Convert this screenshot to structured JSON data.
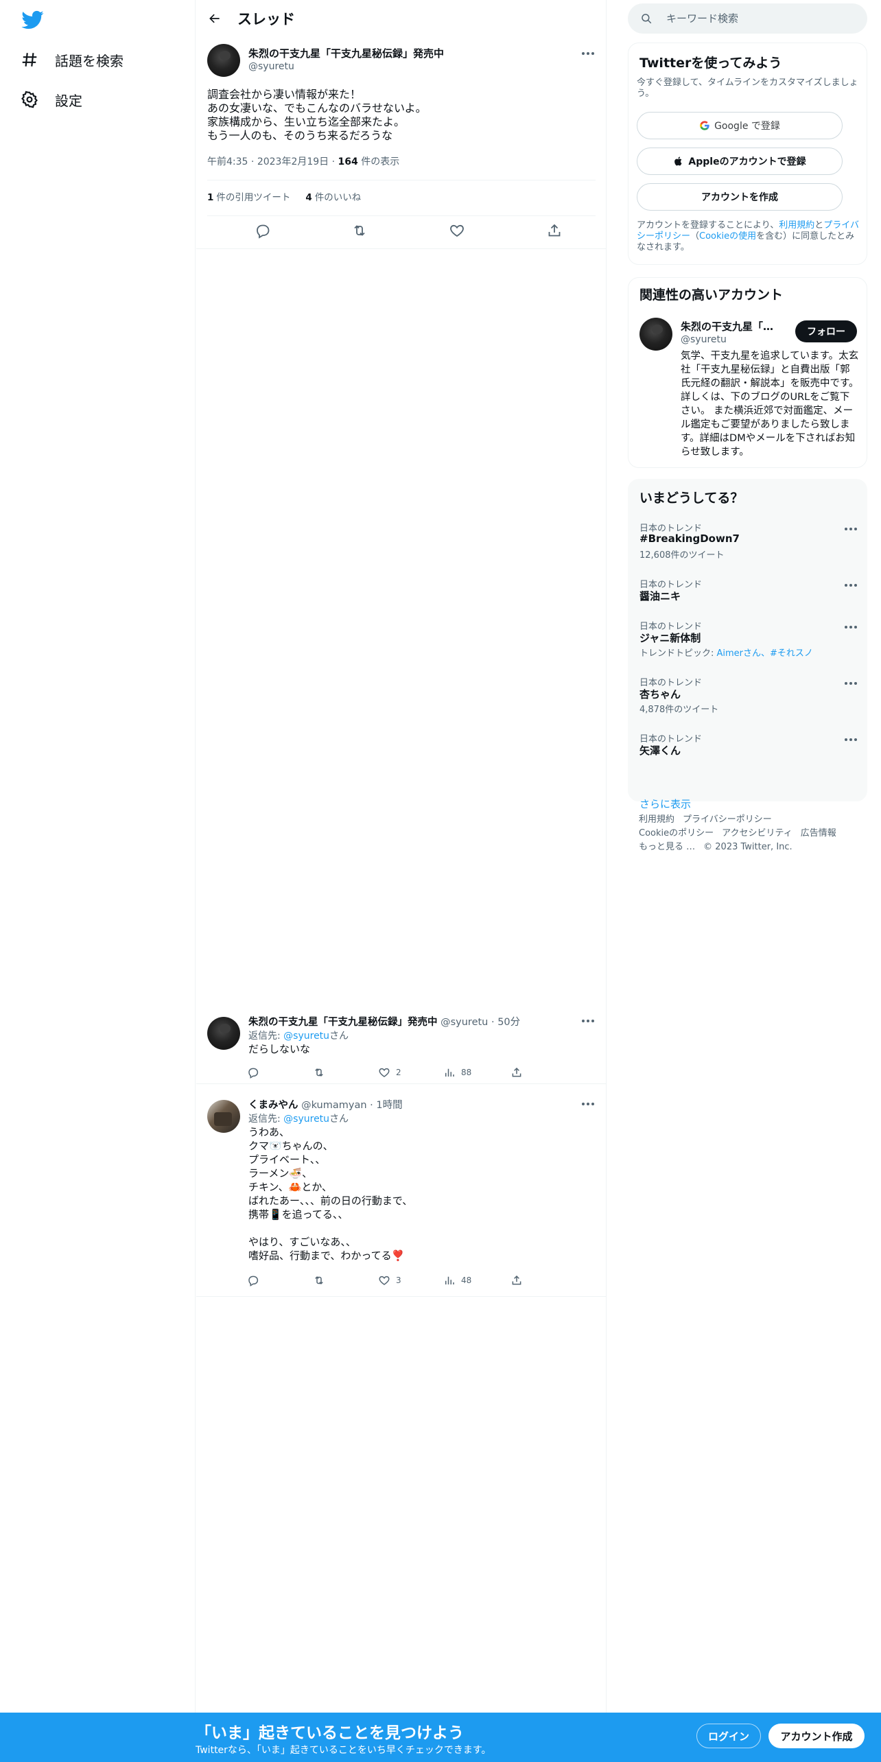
{
  "nav": {
    "items": [
      {
        "label": "話題を検索",
        "icon": "hashtag-icon"
      },
      {
        "label": "設定",
        "icon": "gear-icon"
      }
    ]
  },
  "header": {
    "title": "スレッド"
  },
  "main_tweet": {
    "author_name": "朱烈の干支九星「干支九星秘伝録」発売中",
    "author_handle": "@syuretu",
    "text_lines": [
      "調査会社から凄い情報が来た！",
      "あの女凄いな、でもこんなのバラせないよ。",
      "家族構成から、生い立ち迄全部来たよ。",
      "もう一人のも、そのうち来るだろうな"
    ],
    "time": "午前4:35",
    "date": "2023年2月19日",
    "views_count": "164",
    "views_label": "件の表示",
    "quote_count": "1",
    "quote_label": "件の引用ツイート",
    "like_count": "4",
    "like_label": "件のいいね"
  },
  "replies": [
    {
      "author_name": "朱烈の干支九星「干支九星秘伝録」発売中",
      "author_handle": "@syuretu",
      "time": "· 50分",
      "reply_to_prefix": "返信先: ",
      "reply_to_handle": "@syuretu",
      "reply_to_suffix": "さん",
      "text_lines": [
        "だらしないな"
      ],
      "likes": "2",
      "views": "88"
    },
    {
      "author_name": "くまみやん",
      "author_handle": "@kumamyan",
      "time": "· 1時間",
      "reply_to_prefix": "返信先: ",
      "reply_to_handle": "@syuretu",
      "reply_to_suffix": "さん",
      "text_lines": [
        "うわあ、",
        "クマ🐻‍❄️ちゃんの、",
        "プライベート、、",
        "ラーメン🍜、",
        "チキン、🦀とか、",
        "ばれたあー、、、前の日の行動まで、",
        "携帯📱を追ってる、、",
        "",
        "やはり、すごいなあ、、",
        "嗜好品、行動まで、わかってる❣️"
      ],
      "likes": "3",
      "views": "48"
    }
  ],
  "search": {
    "placeholder": "キーワード検索"
  },
  "signup_card": {
    "title": "Twitterを使ってみよう",
    "desc": "今すぐ登録して、タイムラインをカスタマイズしましょう。",
    "google_label": "Google で登録",
    "apple_label": "Appleのアカウントで登録",
    "create_label": "アカウントを作成",
    "legal_prefix": "アカウントを登録することにより、",
    "legal_terms": "利用規約",
    "legal_and": "と",
    "legal_privacy": "プライバシーポリシー",
    "legal_paren_open": "（",
    "legal_cookie": "Cookieの使用",
    "legal_suffix": "を含む）に同意したとみなされます。"
  },
  "related": {
    "title": "関連性の高いアカウント",
    "name": "朱烈の干支九星「干支九星秘伝録」発売中",
    "handle": "@syuretu",
    "follow_label": "フォロー",
    "bio": "気学、干支九星を追求しています。太玄社「干支九星秘伝録」と自費出版「郭氏元経の翻訳・解説本」を販売中です。詳しくは、下のブログのURLをご覧下さい。 また横浜近郊で対面鑑定、メール鑑定もご要望がありましたら致します。詳細はDMやメールを下さればお知らせ致します。"
  },
  "trends": {
    "title": "いまどうしてる？",
    "items": [
      {
        "context": "日本のトレンド",
        "name": "#BreakingDown7",
        "meta": "12,608件のツイート"
      },
      {
        "context": "日本のトレンド",
        "name": "醤油ニキ",
        "meta": ""
      },
      {
        "context": "日本のトレンド",
        "name": "ジャニ新体制",
        "meta_prefix": "トレンドトピック: ",
        "meta_links": "Aimerさん、#それスノ"
      },
      {
        "context": "日本のトレンド",
        "name": "杏ちゃん",
        "meta": "4,878件のツイート"
      },
      {
        "context": "日本のトレンド",
        "name": "矢澤くん",
        "meta": ""
      }
    ],
    "show_more": "さらに表示"
  },
  "footer": {
    "terms": "利用規約",
    "privacy": "プライバシーポリシー",
    "cookie": "Cookieのポリシー",
    "accessibility": "アクセシビリティ",
    "ads": "広告情報",
    "more": "もっと見る …",
    "copyright": "© 2023 Twitter, Inc."
  },
  "bottom_bar": {
    "title": "「いま」起きていることを見つけよう",
    "subtitle": "Twitterなら、「いま」起きていることをいち早くチェックできます。",
    "login_label": "ログイン",
    "signup_label": "アカウント作成"
  },
  "colors": {
    "accent": "#1d9bf0",
    "text": "#0f1419",
    "secondary": "#536471",
    "border": "#eff3f4"
  }
}
